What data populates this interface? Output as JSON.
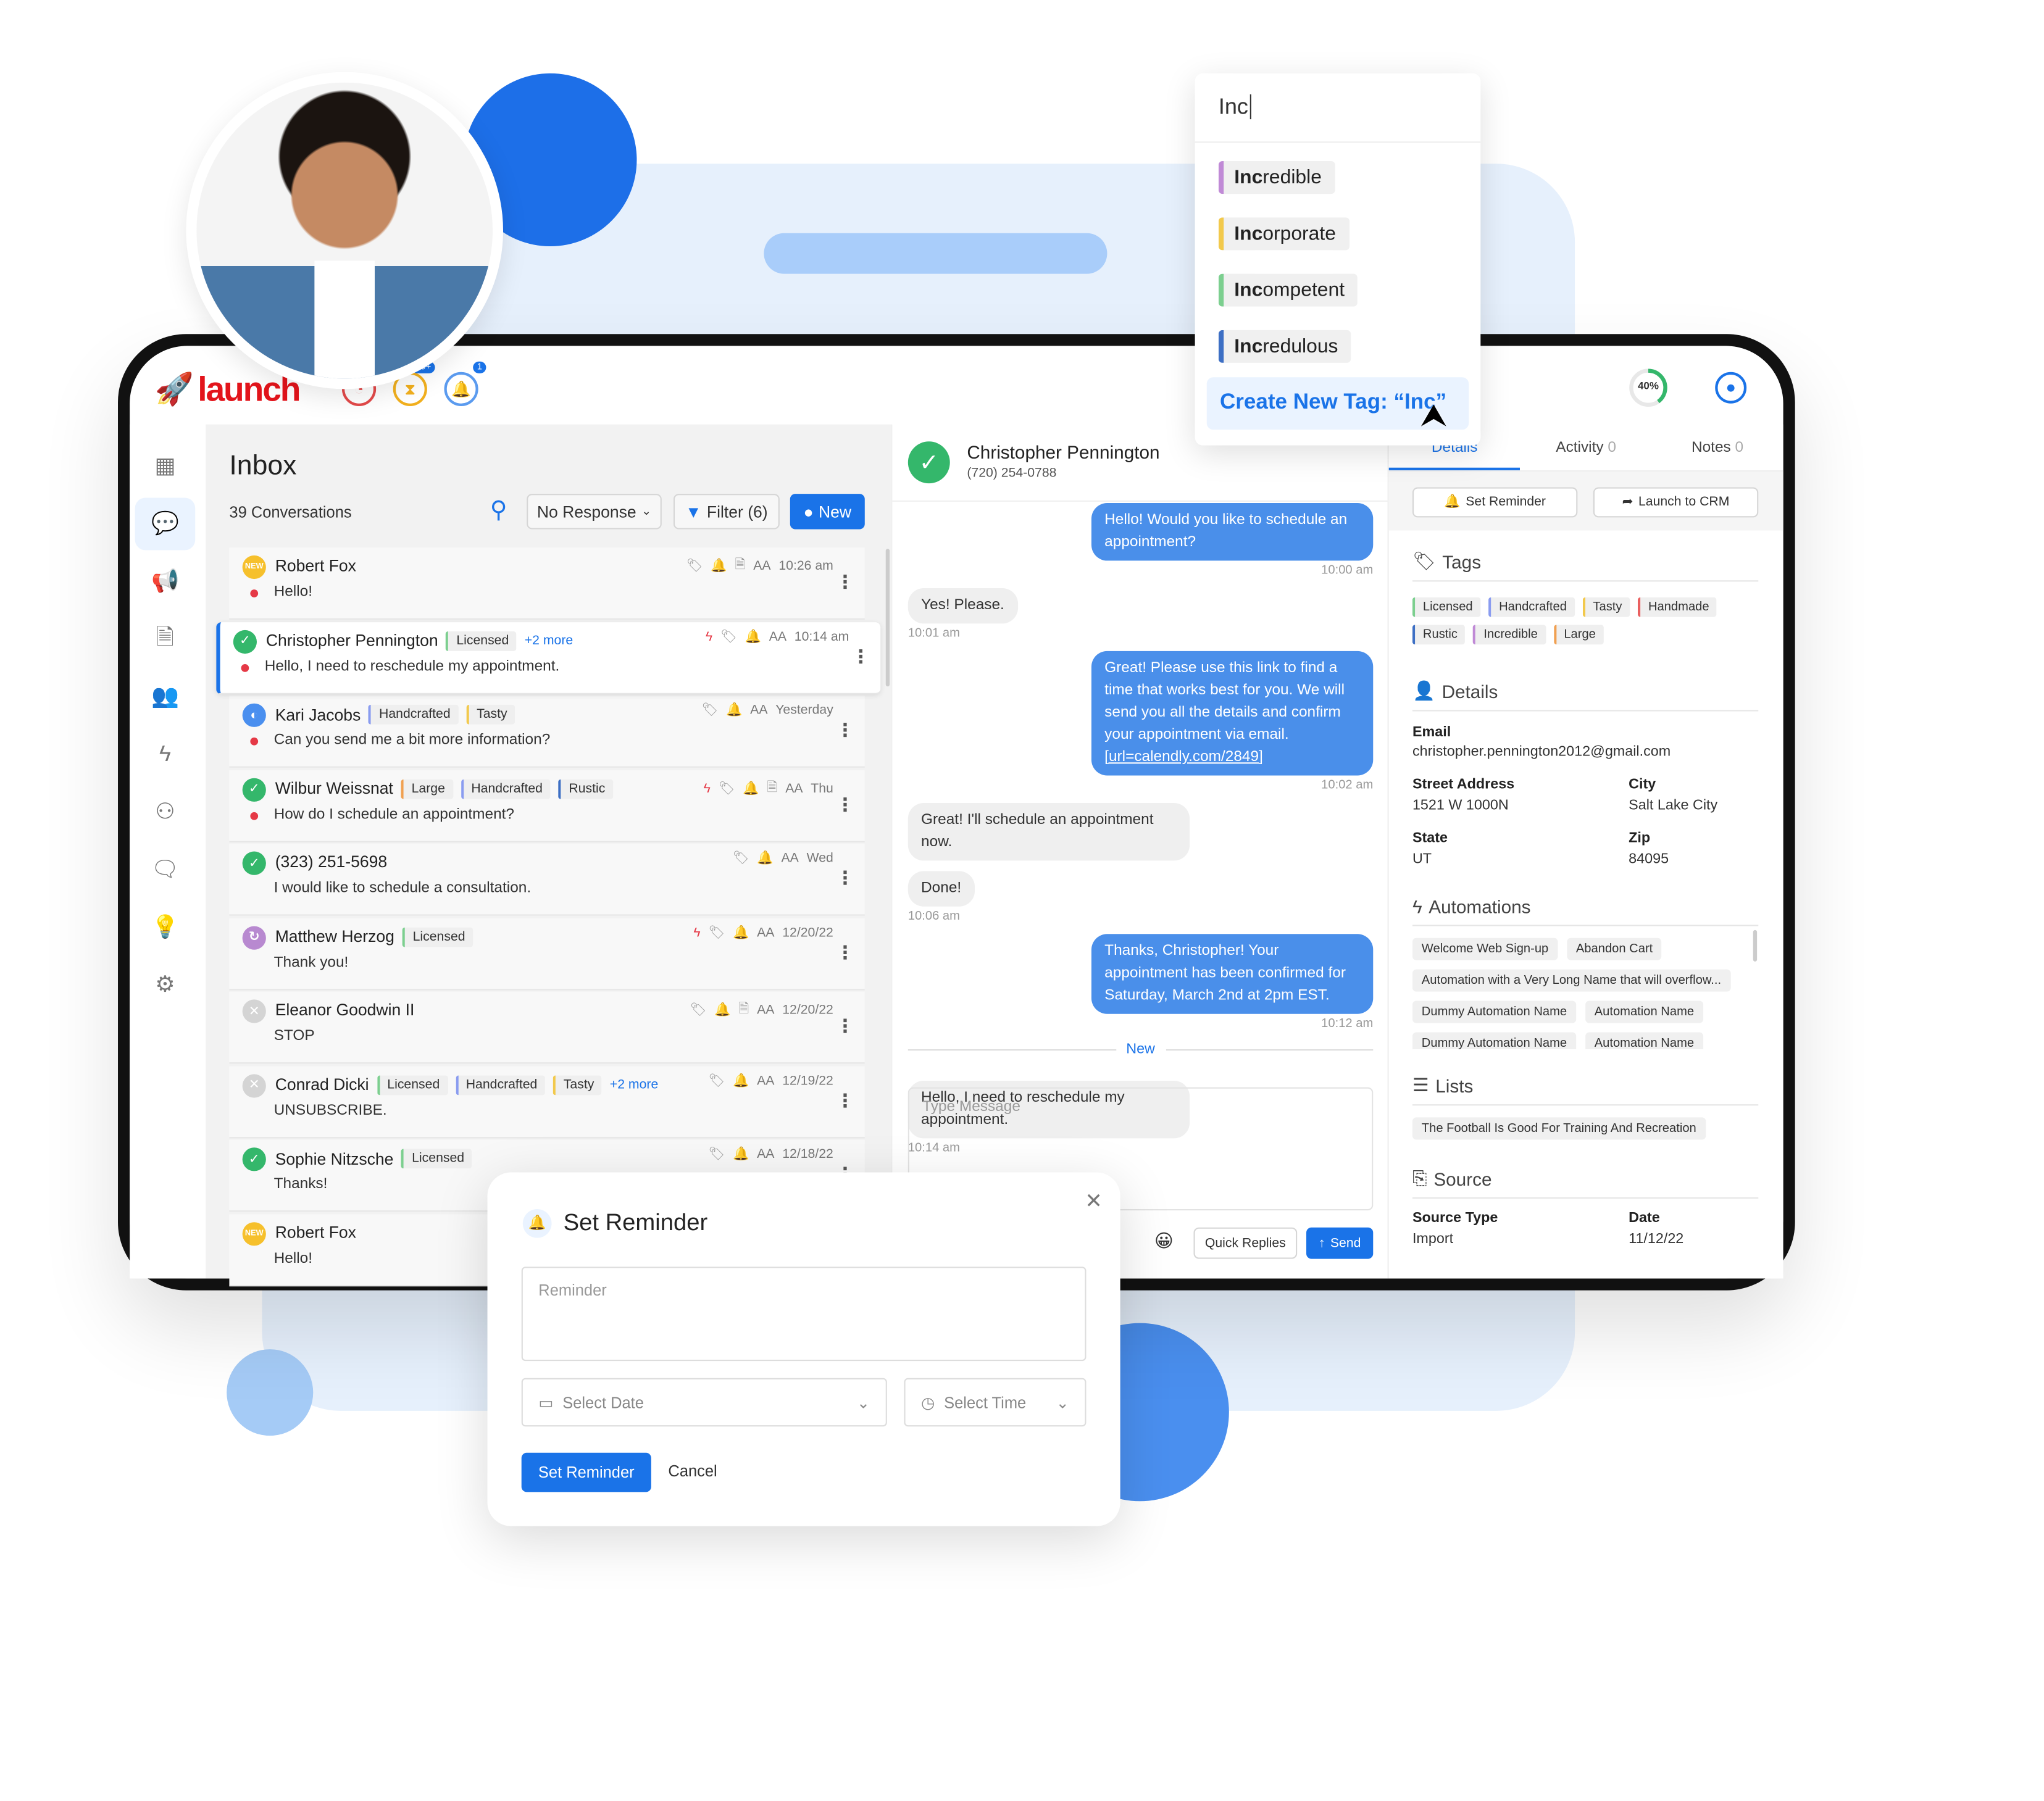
{
  "colors": {
    "accent": "#1a73e8",
    "brand_red": "#e3141b",
    "green": "#34b76b",
    "unread": "#e53946"
  },
  "header": {
    "logo_text": "launch",
    "icons": [
      {
        "name": "speedometer-icon",
        "color": "#e44a4a"
      },
      {
        "name": "hourglass-icon",
        "color": "#f2b01e",
        "badge": "99+"
      },
      {
        "name": "bell-icon",
        "color": "#5b9bef",
        "badge": "1"
      }
    ],
    "progress_percent": 40,
    "progress_label": "40%"
  },
  "sidebar": {
    "items": [
      {
        "icon": "dashboard-icon",
        "glyph": "▦"
      },
      {
        "icon": "chat-icon",
        "glyph": "💬",
        "active": true
      },
      {
        "icon": "megaphone-icon",
        "glyph": "📢"
      },
      {
        "icon": "document-icon",
        "glyph": "🗎"
      },
      {
        "icon": "contacts-icon",
        "glyph": "👥"
      },
      {
        "icon": "lightning-icon",
        "glyph": "ϟ"
      },
      {
        "icon": "org-chart-icon",
        "glyph": "⚇"
      },
      {
        "icon": "support-chat-icon",
        "glyph": "🗨"
      },
      {
        "icon": "lightbulb-icon",
        "glyph": "💡"
      },
      {
        "icon": "settings-icon",
        "glyph": "⚙"
      }
    ]
  },
  "inbox": {
    "title": "Inbox",
    "count": "39 Conversations",
    "filter_select": "No Response",
    "filter_button": "Filter (6)",
    "new_button": "New",
    "conversations": [
      {
        "name": "Robert Fox",
        "status": "new",
        "tags": [],
        "icons": [
          "tag",
          "bell-blue",
          "doc"
        ],
        "aa": "AA",
        "time": "10:26 am",
        "preview": "Hello!",
        "unread": true
      },
      {
        "name": "Christopher Pennington",
        "status": "done",
        "tags": [
          {
            "label": "Licensed",
            "color": "#7ccf8f"
          }
        ],
        "more": "+2 more",
        "icons": [
          "bolt",
          "tag",
          "bell-blue"
        ],
        "aa": "AA",
        "time": "10:14 am",
        "preview": "Hello, I need to reschedule my appointment.",
        "unread": true,
        "selected": true
      },
      {
        "name": "Kari Jacobs",
        "status": "pending",
        "tags": [
          {
            "label": "Handcrafted",
            "color": "#8a9cf0"
          },
          {
            "label": "Tasty",
            "color": "#f2c94c"
          }
        ],
        "icons": [
          "tag",
          "bell"
        ],
        "aa": "AA",
        "time": "Yesterday",
        "preview": "Can you send me a bit more information?",
        "unread": true
      },
      {
        "name": "Wilbur Weissnat",
        "status": "done",
        "tags": [
          {
            "label": "Large",
            "color": "#f0a050"
          },
          {
            "label": "Handcrafted",
            "color": "#8a9cf0"
          },
          {
            "label": "Rustic",
            "color": "#3d6fc4"
          }
        ],
        "icons": [
          "bolt",
          "tag",
          "bell",
          "doc"
        ],
        "aa": "AA",
        "time": "Thu",
        "preview": "How do I schedule an appointment?",
        "unread": true
      },
      {
        "name": "(323) 251-5698",
        "status": "done",
        "tags": [],
        "icons": [
          "tag",
          "bell"
        ],
        "aa": "AA",
        "time": "Wed",
        "preview": "I would like to schedule a consultation.",
        "unread": false
      },
      {
        "name": "Matthew Herzog",
        "status": "recurring",
        "tags": [
          {
            "label": "Licensed",
            "color": "#7ccf8f"
          }
        ],
        "icons": [
          "bolt",
          "tag",
          "bell-blue"
        ],
        "aa": "AA",
        "time": "12/20/22",
        "preview": "Thank you!",
        "unread": false
      },
      {
        "name": "Eleanor Goodwin II",
        "status": "closed",
        "tags": [],
        "icons": [
          "tag",
          "bell",
          "doc"
        ],
        "aa": "AA",
        "time": "12/20/22",
        "preview": "STOP",
        "unread": false
      },
      {
        "name": "Conrad Dicki",
        "status": "closed",
        "tags": [
          {
            "label": "Licensed",
            "color": "#7ccf8f"
          },
          {
            "label": "Handcrafted",
            "color": "#8a9cf0"
          },
          {
            "label": "Tasty",
            "color": "#f2c94c"
          }
        ],
        "more": "+2 more",
        "icons": [
          "tag",
          "bell-blue"
        ],
        "aa": "AA",
        "time": "12/19/22",
        "preview": "UNSUBSCRIBE.",
        "unread": false
      },
      {
        "name": "Sophie Nitzsche",
        "status": "done",
        "tags": [
          {
            "label": "Licensed",
            "color": "#7ccf8f"
          }
        ],
        "icons": [
          "tag",
          "bell-blue"
        ],
        "aa": "AA",
        "time": "12/18/22",
        "preview": "Thanks!",
        "unread": false
      },
      {
        "name": "Robert Fox",
        "status": "new",
        "tags": [],
        "icons": [],
        "aa": "",
        "time": "",
        "preview": "Hello!",
        "unread": false
      }
    ]
  },
  "chat": {
    "contact_name": "Christopher Pennington",
    "contact_phone": "(720) 254-0788",
    "messages": [
      {
        "dir": "out",
        "text": "Hello! Would you like to schedule an appointment?",
        "time": "10:00 am"
      },
      {
        "dir": "in",
        "text": "Yes! Please.",
        "time": "10:01 am"
      },
      {
        "dir": "out",
        "text": "Great! Please use this link to find a time that works best for you. We will send you all the details and confirm your appointment via email.",
        "link": "[url=calendly.com/2849]",
        "time": "10:02 am"
      },
      {
        "dir": "in",
        "text": "Great! I'll schedule an appointment now.",
        "time": ""
      },
      {
        "dir": "in",
        "text": "Done!",
        "time": "10:06 am"
      },
      {
        "dir": "out",
        "text": "Thanks, Christopher! Your appointment has been confirmed for Saturday, March 2nd at 2pm EST.",
        "time": "10:12 am"
      },
      {
        "dir": "divider",
        "text": "New"
      },
      {
        "dir": "in",
        "text": "Hello, I need to reschedule my appointment.",
        "time": "10:14 am"
      }
    ],
    "input_placeholder": "Type Message",
    "quick_replies": "Quick Replies",
    "send": "Send"
  },
  "details": {
    "tabs": [
      {
        "label": "Details",
        "active": true
      },
      {
        "label": "Activity",
        "count": "0"
      },
      {
        "label": "Notes",
        "count": "0"
      }
    ],
    "set_reminder": "Set Reminder",
    "launch_crm": "Launch to CRM",
    "tags_title": "Tags",
    "tags": [
      {
        "label": "Licensed",
        "color": "#7ccf8f"
      },
      {
        "label": "Handcrafted",
        "color": "#8a9cf0"
      },
      {
        "label": "Tasty",
        "color": "#f2c94c"
      },
      {
        "label": "Handmade",
        "color": "#ea6060"
      },
      {
        "label": "Rustic",
        "color": "#3d6fc4"
      },
      {
        "label": "Incredible",
        "color": "#c08ad6"
      },
      {
        "label": "Large",
        "color": "#f0a050"
      }
    ],
    "details_title": "Details",
    "email_label": "Email",
    "email": "christopher.pennington2012@gmail.com",
    "street_label": "Street Address",
    "street": "1521 W 1000N",
    "city_label": "City",
    "city": "Salt Lake City",
    "state_label": "State",
    "state": "UT",
    "zip_label": "Zip",
    "zip": "84095",
    "automations_title": "Automations",
    "automations": [
      "Welcome Web Sign-up",
      "Abandon Cart",
      "Automation with a Very Long Name that will overflow...",
      "Dummy Automation Name",
      "Automation Name",
      "Dummy Automation Name",
      "Automation Name"
    ],
    "lists_title": "Lists",
    "lists": [
      "The Football Is Good For Training And Recreation"
    ],
    "source_title": "Source",
    "source_type_label": "Source Type",
    "source_type": "Import",
    "date_label": "Date",
    "date": "11/12/22"
  },
  "tag_dropdown": {
    "query": "Inc",
    "options": [
      {
        "match": "Inc",
        "rest": "redible",
        "color": "#c08ad6"
      },
      {
        "match": "Inc",
        "rest": "orporate",
        "color": "#f2c94c"
      },
      {
        "match": "Inc",
        "rest": "ompetent",
        "color": "#7ccf8f"
      },
      {
        "match": "Inc",
        "rest": "redulous",
        "color": "#3d6fc4"
      }
    ],
    "create_label": "Create New Tag: “Inc”"
  },
  "reminder_modal": {
    "title": "Set Reminder",
    "reminder_placeholder": "Reminder",
    "date_placeholder": "Select Date",
    "time_placeholder": "Select Time",
    "submit": "Set Reminder",
    "cancel": "Cancel"
  }
}
